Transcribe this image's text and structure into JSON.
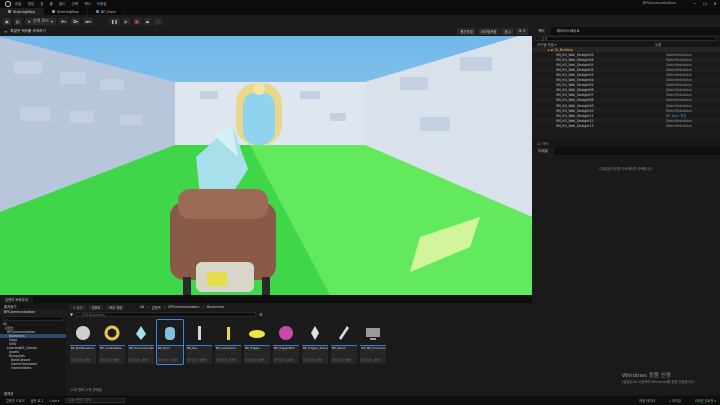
{
  "titlebar": {
    "menus": [
      "파일",
      "편집",
      "창",
      "툴",
      "빌드",
      "선택",
      "액터",
      "도움말"
    ],
    "app_title": "BPCommunication",
    "minimize": "─",
    "maximize": "☐",
    "close": "✕"
  },
  "tabs": [
    {
      "label": "StartingMap"
    },
    {
      "label": "StartingMap"
    },
    {
      "label": "BP_Door"
    }
  ],
  "toolbar": {
    "mode_label": "선택 모드",
    "play": "▶",
    "pause": "❚❚",
    "stop": "■",
    "eject": "⏏",
    "more": "⋮"
  },
  "viewport": {
    "header_label": "파일럿 액터를 추적하기",
    "tools": [
      "원근투영",
      "라이팅포함",
      "표시",
      "⚙ 3"
    ]
  },
  "outliner": {
    "tab_outliner": "액터",
    "tab_layers": "레이어스테이트",
    "search_placeholder": "검색",
    "col_label": "아이템 라벨 ▾",
    "col_type": "유형",
    "folder": "10_Building",
    "rows": [
      {
        "name": "SM_KG_Wall_Straight03",
        "type": "StaticMeshActor"
      },
      {
        "name": "SM_KG_Wall_Straight04",
        "type": "StaticMeshActor"
      },
      {
        "name": "SM_KG_Wall_Straight05",
        "type": "StaticMeshActor"
      },
      {
        "name": "SM_KG_Wall_Straight02",
        "type": "StaticMeshActor"
      },
      {
        "name": "SM_KG_Wall_Straight03",
        "type": "StaticMeshActor"
      },
      {
        "name": "SM_KG_Wall_Straight04",
        "type": "StaticMeshActor"
      },
      {
        "name": "SM_KG_Wall_Straight05",
        "type": "StaticMeshActor"
      },
      {
        "name": "SM_KG_Wall_Straight06",
        "type": "StaticMeshActor"
      },
      {
        "name": "SM_KG_Wall_Straight07",
        "type": "StaticMeshActor"
      },
      {
        "name": "SM_KG_Wall_Straight08",
        "type": "StaticMeshActor"
      },
      {
        "name": "SM_KG_Wall_Straight09",
        "type": "StaticMeshActor"
      },
      {
        "name": "SM_KG_Wall_Straight10",
        "type": "StaticMeshActor"
      },
      {
        "name": "SM_KG_Wall_Straight11",
        "type": "BP_Door 편집"
      },
      {
        "name": "SM_KG_Wall_Straight12",
        "type": "StaticMeshActor"
      },
      {
        "name": "SM_KG_Wall_Straight13",
        "type": "StaticMeshActor"
      }
    ],
    "status": "22 액터"
  },
  "details": {
    "tab": "디테일",
    "message": "디테일을 보려면 오브젝트를 선택합니다."
  },
  "watermark": {
    "line1": "Windows 정품 인증",
    "line2": "[설정]으로 이동하여 Windows를 정품 인증합니다."
  },
  "content_browser": {
    "tab": "콘텐츠 브라우저",
    "add": "+ 추가",
    "import": "임포트",
    "save_all": "모두 저장",
    "breadcrumb": [
      "All",
      "콘텐츠",
      "BPCommunication",
      "Blueprints"
    ],
    "favorites": "즐겨찾기",
    "project": "BPCommunication",
    "search_placeholder": "검색 Blueprints",
    "tree": [
      "All",
      "콘텐츠",
      "BPCommunication",
      "Blueprints",
      "Maps",
      "UMG",
      "LearningKit_Games",
      "Assets",
      "Blueprints",
      "BaseClasses",
      "GameFramework",
      "Interactables"
    ],
    "collections": "컬렉션",
    "assets": [
      {
        "name": "BP_BallSpawner",
        "type": "블루프린트 클래스"
      },
      {
        "name": "BP_CollectAble",
        "type": "블루프린트 클래스"
      },
      {
        "name": "BP_Communication_Character",
        "type": "블루프린트 클래스"
      },
      {
        "name": "BP_Door",
        "type": "블루프린트 클래스"
      },
      {
        "name": "BP_Key",
        "type": "블루프린트 클래스"
      },
      {
        "name": "BP_LeverDoor",
        "type": "블루프린트 클래스"
      },
      {
        "name": "BP_Trigger",
        "type": "블루프린트 클래스"
      },
      {
        "name": "BP_TriggerBall",
        "type": "블루프린트 클래스"
      },
      {
        "name": "BP_Trigger_Pickup",
        "type": "블루프린트 클래스"
      },
      {
        "name": "BP_Wand",
        "type": "블루프린트 클래스"
      },
      {
        "name": "CM_BP_Communication",
        "type": "블루프린트 클래스"
      }
    ],
    "count": "11개 항목 (1개 선택됨)"
  },
  "statusbar": {
    "content_drawer": "콘텐츠 드로어",
    "output_log": "출력 로그",
    "cmd": "Cmd ▾",
    "cmd_placeholder": "콘솔 커맨드 입력",
    "derived": "파생 데이터",
    "unsaved": "1 미저장",
    "revision": "리비전 컨트롤 ▾"
  },
  "colors": {
    "accent": "#3a8ae0",
    "folder": "#e6c36a",
    "play": "#4ac04a",
    "stop": "#e04040"
  }
}
